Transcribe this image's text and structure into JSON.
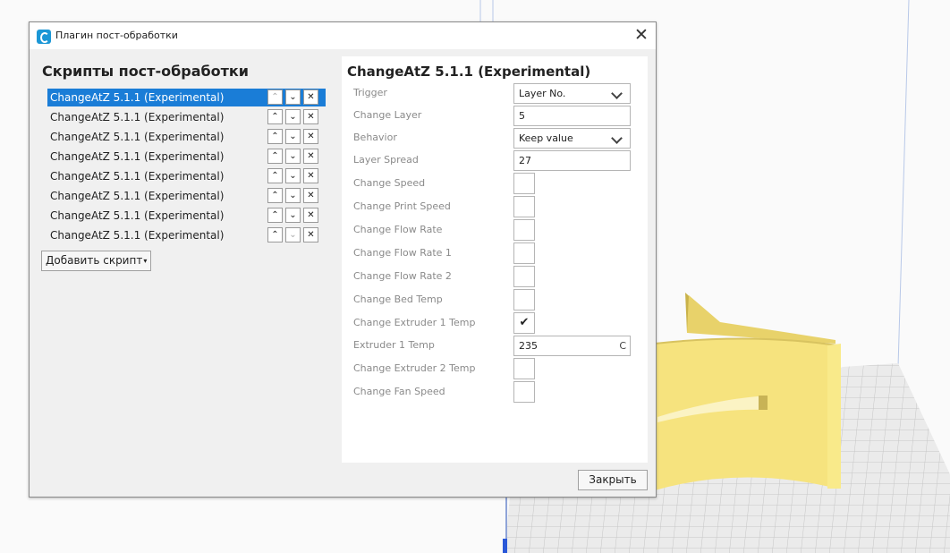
{
  "dialog": {
    "title": "Плагин пост-обработки",
    "close_glyph": "✕"
  },
  "left": {
    "heading": "Скрипты пост-обработки",
    "scripts": [
      {
        "name": "ChangeAtZ 5.1.1 (Experimental)",
        "selected": true,
        "up_enabled": false,
        "down_enabled": true
      },
      {
        "name": "ChangeAtZ 5.1.1 (Experimental)",
        "selected": false,
        "up_enabled": true,
        "down_enabled": true
      },
      {
        "name": "ChangeAtZ 5.1.1 (Experimental)",
        "selected": false,
        "up_enabled": true,
        "down_enabled": true
      },
      {
        "name": "ChangeAtZ 5.1.1 (Experimental)",
        "selected": false,
        "up_enabled": true,
        "down_enabled": true
      },
      {
        "name": "ChangeAtZ 5.1.1 (Experimental)",
        "selected": false,
        "up_enabled": true,
        "down_enabled": true
      },
      {
        "name": "ChangeAtZ 5.1.1 (Experimental)",
        "selected": false,
        "up_enabled": true,
        "down_enabled": true
      },
      {
        "name": "ChangeAtZ 5.1.1 (Experimental)",
        "selected": false,
        "up_enabled": true,
        "down_enabled": true
      },
      {
        "name": "ChangeAtZ 5.1.1 (Experimental)",
        "selected": false,
        "up_enabled": true,
        "down_enabled": false
      }
    ],
    "control_glyphs": {
      "up": "⌃",
      "down": "⌄",
      "delete": "✕"
    },
    "add_button": "Добавить скрипт",
    "add_caret": "▾"
  },
  "right": {
    "heading": "ChangeAtZ 5.1.1 (Experimental)",
    "settings": [
      {
        "label": "Trigger",
        "type": "combo",
        "value": "Layer No."
      },
      {
        "label": "Change Layer",
        "type": "text",
        "value": "5"
      },
      {
        "label": "Behavior",
        "type": "combo",
        "value": "Keep value"
      },
      {
        "label": "Layer Spread",
        "type": "text",
        "value": "27"
      },
      {
        "label": "Change Speed",
        "type": "checkbox",
        "checked": false
      },
      {
        "label": "Change Print Speed",
        "type": "checkbox",
        "checked": false
      },
      {
        "label": "Change Flow Rate",
        "type": "checkbox",
        "checked": false
      },
      {
        "label": "Change Flow Rate 1",
        "type": "checkbox",
        "checked": false
      },
      {
        "label": "Change Flow Rate 2",
        "type": "checkbox",
        "checked": false
      },
      {
        "label": "Change Bed Temp",
        "type": "checkbox",
        "checked": false
      },
      {
        "label": "Change Extruder 1 Temp",
        "type": "checkbox",
        "checked": true
      },
      {
        "label": "Extruder 1 Temp",
        "type": "text",
        "value": "235",
        "unit": "C"
      },
      {
        "label": "Change Extruder 2 Temp",
        "type": "checkbox",
        "checked": false
      },
      {
        "label": "Change Fan Speed",
        "type": "checkbox",
        "checked": false
      }
    ],
    "check_glyph": "✔"
  },
  "footer": {
    "close_button": "Закрыть"
  },
  "colors": {
    "selection": "#1a7dd7",
    "model_yellow": "#f4e07c",
    "build_plate": "#e9e9e9",
    "grid_line": "#c9c9c9",
    "axis_blue": "#2a58d8"
  }
}
